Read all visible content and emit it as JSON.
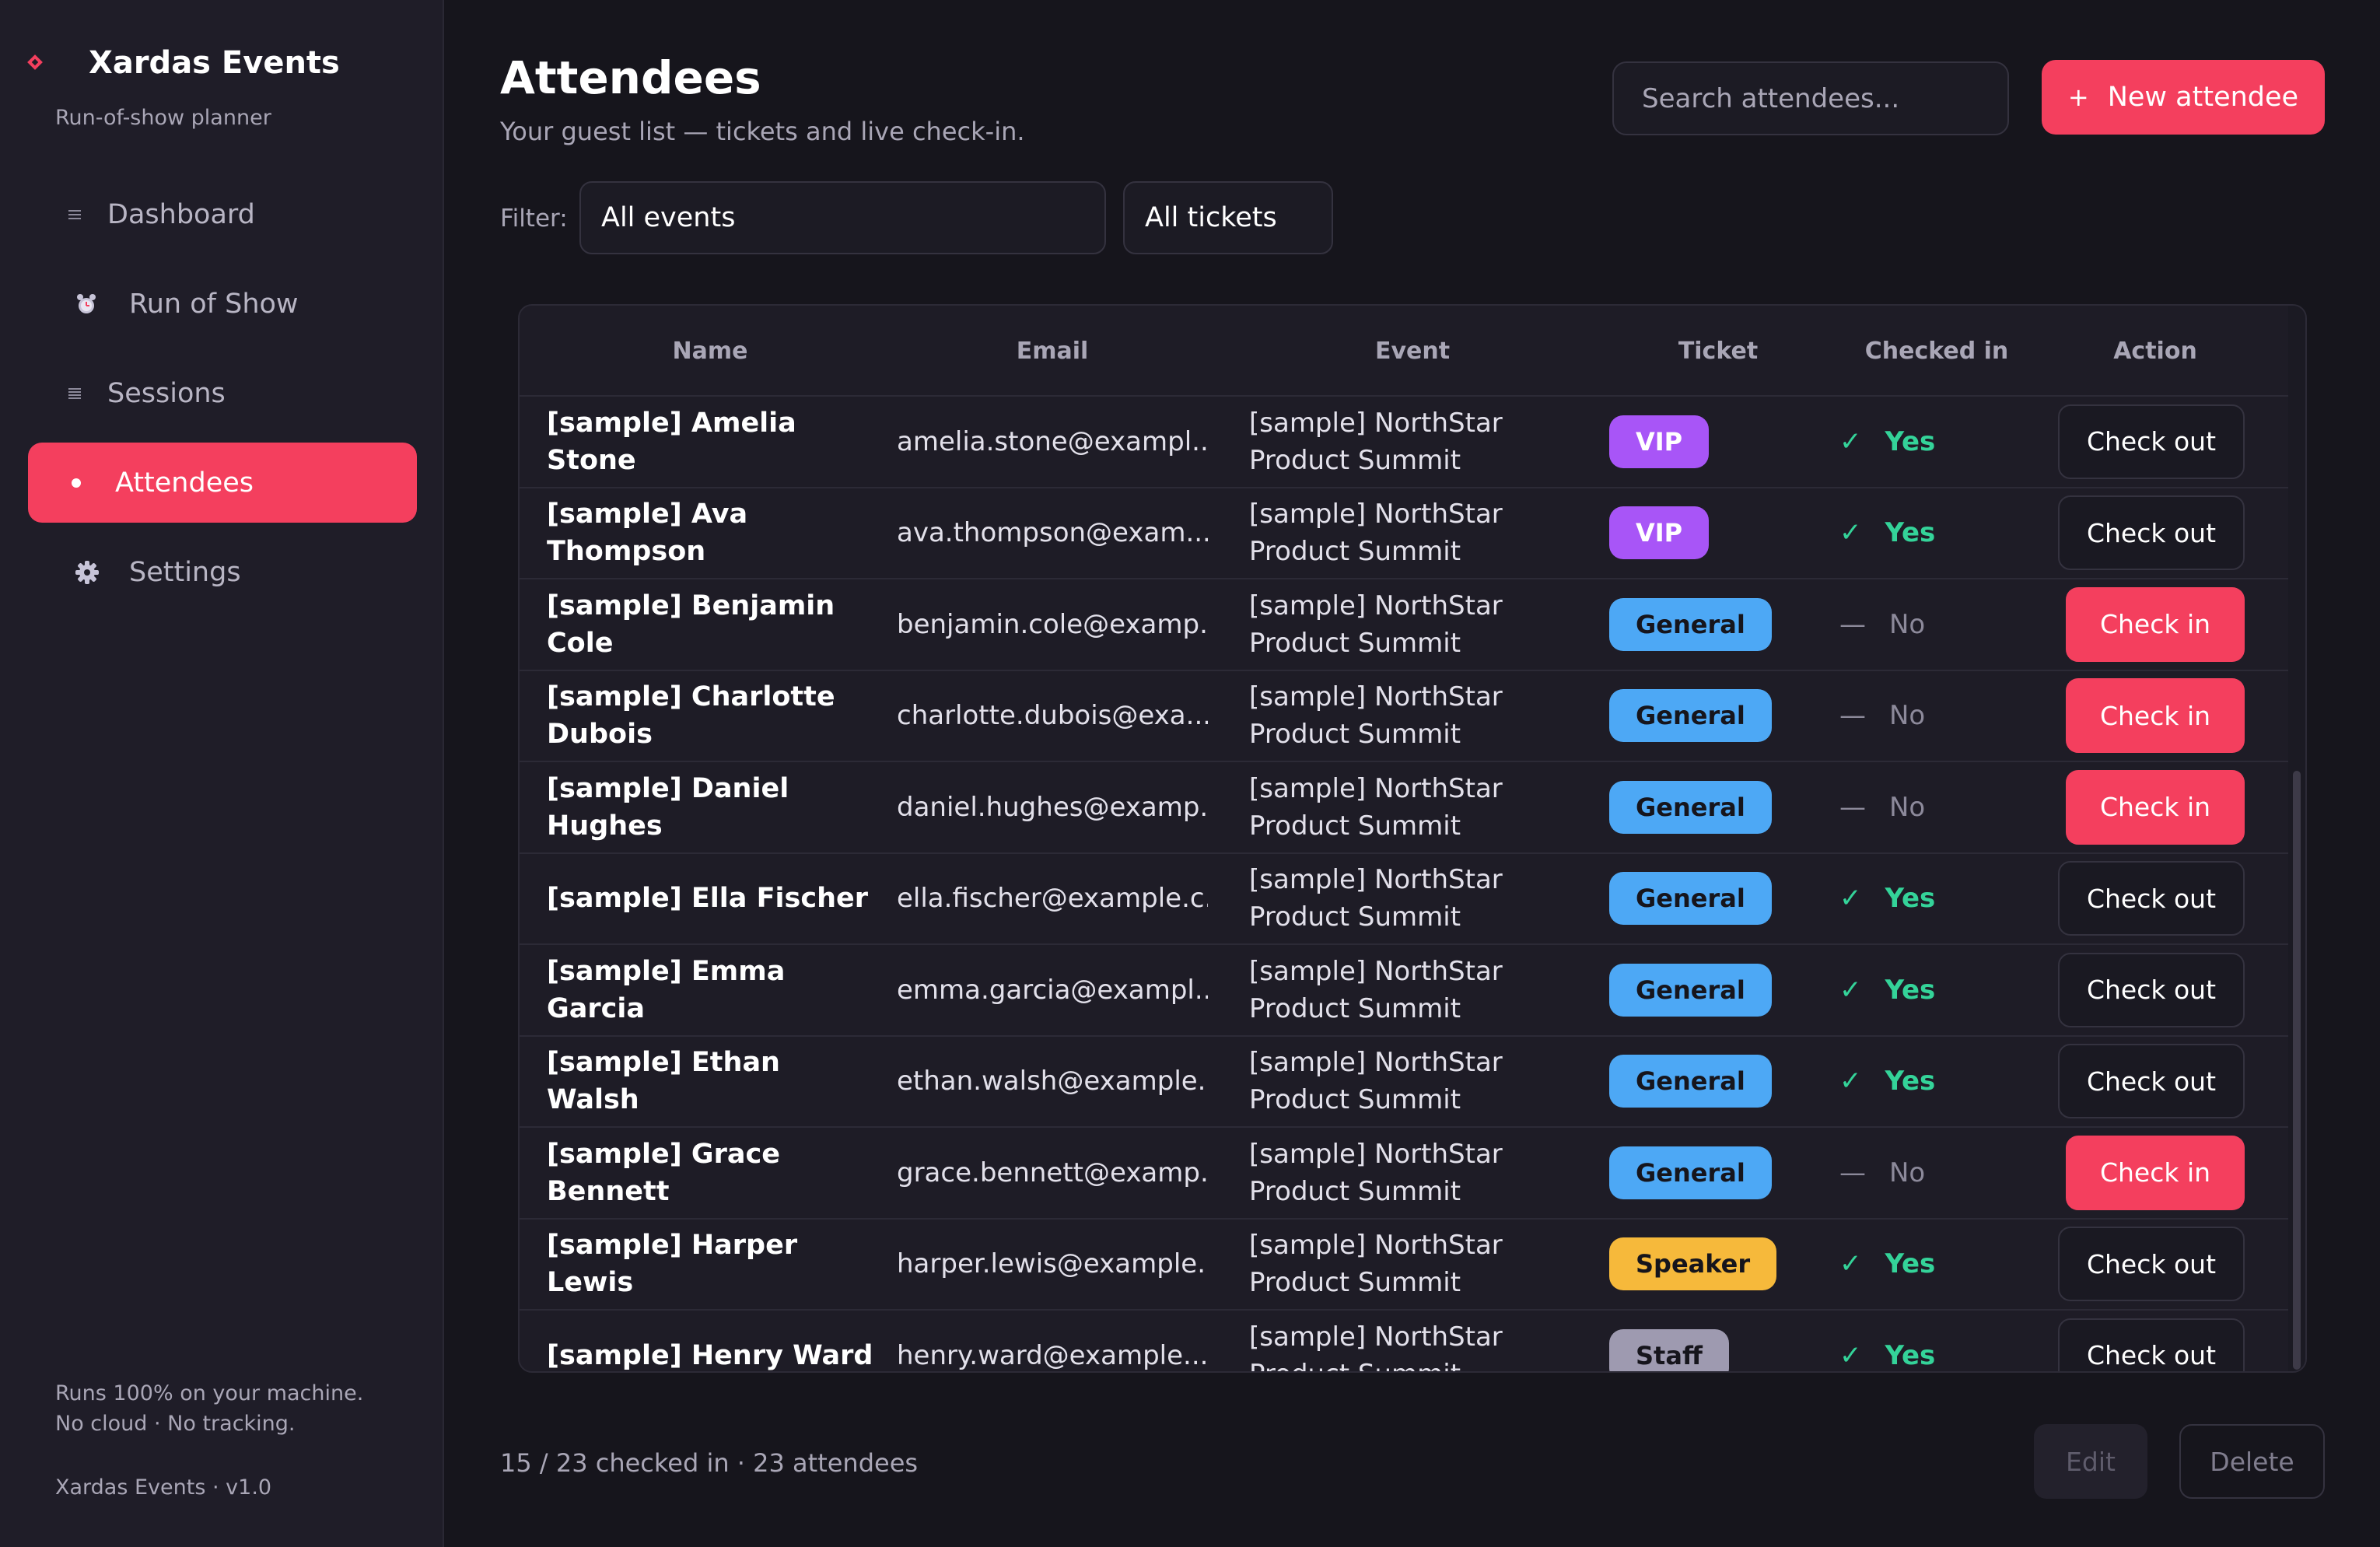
{
  "sidebar": {
    "brand_name": "Xardas Events",
    "brand_sub": "Run-of-show planner",
    "items": [
      {
        "label": "Dashboard",
        "icon": "dashboard-icon"
      },
      {
        "label": "Run of Show",
        "icon": "alarm-clock-icon"
      },
      {
        "label": "Sessions",
        "icon": "list-icon"
      },
      {
        "label": "Attendees",
        "icon": "dot-icon",
        "active": true
      },
      {
        "label": "Settings",
        "icon": "gear-icon"
      }
    ],
    "footer_line1": "Runs 100% on your machine.",
    "footer_line2": "No cloud · No tracking.",
    "version": "Xardas Events · v1.0"
  },
  "header": {
    "title": "Attendees",
    "subtitle": "Your guest list — tickets and live check-in.",
    "search_placeholder": "Search attendees...",
    "new_button_label": "New attendee",
    "new_button_icon": "+"
  },
  "filters": {
    "label": "Filter:",
    "events_value": "All events",
    "tickets_value": "All tickets"
  },
  "table": {
    "columns": [
      "Name",
      "Email",
      "Event",
      "Ticket",
      "Checked in",
      "Action"
    ],
    "rows": [
      {
        "name": "[sample] Amelia Stone",
        "email": "amelia.stone@exampl...",
        "event": "[sample] NorthStar Product Summit",
        "ticket": "VIP",
        "checked": "Yes",
        "action": "Check out"
      },
      {
        "name": "[sample] Ava Thompson",
        "email": "ava.thompson@exam...",
        "event": "[sample] NorthStar Product Summit",
        "ticket": "VIP",
        "checked": "Yes",
        "action": "Check out"
      },
      {
        "name": "[sample] Benjamin Cole",
        "email": "benjamin.cole@examp...",
        "event": "[sample] NorthStar Product Summit",
        "ticket": "General",
        "checked": "No",
        "action": "Check in"
      },
      {
        "name": "[sample] Charlotte Dubois",
        "email": "charlotte.dubois@exa...",
        "event": "[sample] NorthStar Product Summit",
        "ticket": "General",
        "checked": "No",
        "action": "Check in"
      },
      {
        "name": "[sample] Daniel Hughes",
        "email": "daniel.hughes@examp...",
        "event": "[sample] NorthStar Product Summit",
        "ticket": "General",
        "checked": "No",
        "action": "Check in"
      },
      {
        "name": "[sample] Ella Fischer",
        "email": "ella.fischer@example.c...",
        "event": "[sample] NorthStar Product Summit",
        "ticket": "General",
        "checked": "Yes",
        "action": "Check out"
      },
      {
        "name": "[sample] Emma Garcia",
        "email": "emma.garcia@exampl...",
        "event": "[sample] NorthStar Product Summit",
        "ticket": "General",
        "checked": "Yes",
        "action": "Check out"
      },
      {
        "name": "[sample] Ethan Walsh",
        "email": "ethan.walsh@example....",
        "event": "[sample] NorthStar Product Summit",
        "ticket": "General",
        "checked": "Yes",
        "action": "Check out"
      },
      {
        "name": "[sample] Grace Bennett",
        "email": "grace.bennett@examp...",
        "event": "[sample] NorthStar Product Summit",
        "ticket": "General",
        "checked": "No",
        "action": "Check in"
      },
      {
        "name": "[sample] Harper Lewis",
        "email": "harper.lewis@example...",
        "event": "[sample] NorthStar Product Summit",
        "ticket": "Speaker",
        "checked": "Yes",
        "action": "Check out"
      },
      {
        "name": "[sample] Henry Ward",
        "email": "henry.ward@example....",
        "event": "[sample] NorthStar Product Summit",
        "ticket": "Staff",
        "checked": "Yes",
        "action": "Check out"
      }
    ],
    "yes_mark": "✓",
    "no_mark": "—"
  },
  "ticket_colors": {
    "VIP": {
      "bg": "#a855f7",
      "fg": "#ffffff"
    },
    "General": {
      "bg": "#4da8f5",
      "fg": "#16151c"
    },
    "Speaker": {
      "bg": "#f6b93b",
      "fg": "#16151c"
    },
    "Staff": {
      "bg": "#9e9ab0",
      "fg": "#16151c"
    }
  },
  "footer": {
    "status": "15 / 23 checked in  ·  23 attendees",
    "edit_label": "Edit",
    "delete_label": "Delete"
  },
  "colors": {
    "accent": "#f43f5e",
    "success": "#34d399",
    "background": "#16151c",
    "sidebar": "#1f1d28"
  }
}
